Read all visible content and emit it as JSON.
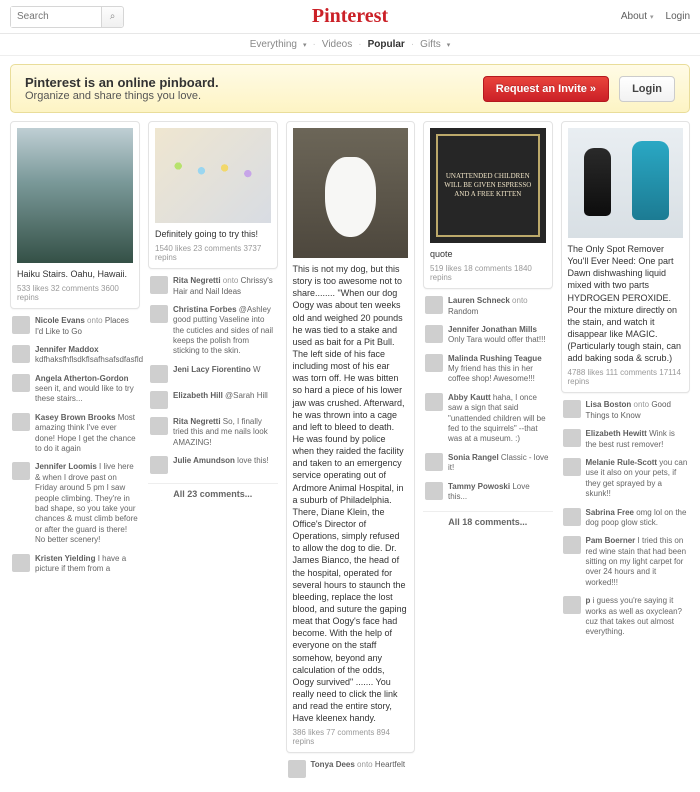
{
  "header": {
    "search_placeholder": "Search",
    "logo": "Pinterest",
    "about": "About",
    "login": "Login"
  },
  "categories": {
    "everything": "Everything",
    "videos": "Videos",
    "popular": "Popular",
    "gifts": "Gifts"
  },
  "banner": {
    "title": "Pinterest is an online pinboard.",
    "subtitle": "Organize and share things you love.",
    "request": "Request an Invite »",
    "login": "Login"
  },
  "pins": {
    "p1": {
      "desc": "Haiku Stairs. Oahu, Hawaii.",
      "stats": "533 likes  32 comments  3600 repins",
      "comments": [
        {
          "name": "Nicole Evans",
          "onto": "onto",
          "board": "Places I'd Like to Go",
          "text": ""
        },
        {
          "name": "Jennifer Maddox",
          "text": "kdfhaksfhflsdkflsafhsafsdfasfld"
        },
        {
          "name": "Angela Atherton-Gordon",
          "text": "seen it, and would like to try these stairs..."
        },
        {
          "name": "Kasey Brown Brooks",
          "text": "Most amazing think I've ever done! Hope I get the chance to do it again"
        },
        {
          "name": "Jennifer Loomis",
          "text": "I live here & when I drove past on Friday around 5 pm I saw people climbing. They're in bad shape, so you take your chances & must climb before or after the guard is there! No better scenery!"
        },
        {
          "name": "Kristen Yielding",
          "text": "I have a picture if them from a"
        }
      ]
    },
    "p2": {
      "desc": "Definitely going to try this!",
      "stats": "1540 likes  23 comments  3737 repins",
      "comments": [
        {
          "name": "Rita Negretti",
          "onto": "onto",
          "board": "Chrissy's Hair and Nail Ideas",
          "text": ""
        },
        {
          "name": "Christina Forbes",
          "text": "@Ashley good putting Vaseline into the cuticles and sides of nail keeps the polish from sticking to the skin."
        },
        {
          "name": "Jeni Lacy Fiorentino",
          "text": "W"
        },
        {
          "name": "Elizabeth Hill",
          "text": "@Sarah Hill"
        },
        {
          "name": "Rita Negretti",
          "text": "So, I finally tried this and me nails look AMAZING!"
        },
        {
          "name": "Julie Amundson",
          "text": "love this!"
        }
      ],
      "all": "All 23 comments..."
    },
    "p3": {
      "desc": "This is not my dog, but this story is too awesome not to share........ \"When our dog Oogy was about ten weeks old and weighed 20 pounds he was tied to a stake and used as bait for a Pit Bull. The left side of his face including most of his ear was torn off. He was bitten so hard a piece of his lower jaw was crushed. Afterward, he was thrown into a cage and left to bleed to death. He was found by police when they raided the facility and taken to an emergency service operating out of Ardmore Animal Hospital, in a suburb of Philadelphia. There, Diane Klein, the Office's Director of Operations, simply refused to allow the dog to die. Dr. James Bianco, the head of the hospital, operated for several hours to staunch the bleeding, replace the lost blood, and suture the gaping meat that Oogy's face had become. With the help of everyone on the staff somehow, beyond any calculation of the odds, Oogy survived\" ....... You really need to click the link and read the entire story, Have kleenex handy.",
      "stats": "386 likes  77 comments  894 repins",
      "comments": [
        {
          "name": "Tonya Dees",
          "onto": "onto",
          "board": "Heartfelt",
          "text": ""
        }
      ]
    },
    "p4": {
      "chalk_text": "UNATTENDED CHILDREN WILL BE GIVEN ESPRESSO AND A FREE KITTEN",
      "desc": "quote",
      "stats": "519 likes  18 comments  1840 repins",
      "comments": [
        {
          "name": "Lauren Schneck",
          "onto": "onto",
          "board": "Random",
          "text": ""
        },
        {
          "name": "Jennifer Jonathan Mills",
          "text": "Only Tara would offer that!!!"
        },
        {
          "name": "Malinda Rushing Teague",
          "text": "My friend has this in her coffee shop! Awesome!!!"
        },
        {
          "name": "Abby Kautt",
          "text": "haha, I once saw a sign that said \"unattended children will be fed to the squirrels\" --that was at a museum. :)"
        },
        {
          "name": "Sonia Rangel",
          "text": "Classic - love it!"
        },
        {
          "name": "Tammy Powoski",
          "text": "Love this..."
        }
      ],
      "all": "All 18 comments..."
    },
    "p5": {
      "desc": "The Only Spot Remover You'll Ever Need: One part Dawn dishwashing liquid mixed with two parts HYDROGEN PEROXIDE. Pour the mixture directly on the stain, and watch it disappear like MAGIC. (Particularly tough stain, can add baking soda & scrub.)",
      "stats": "4788 likes  111 comments  17114 repins",
      "comments": [
        {
          "name": "Lisa Boston",
          "onto": "onto",
          "board": "Good Things to Know",
          "text": ""
        },
        {
          "name": "Elizabeth Hewitt",
          "text": "Wink is the best rust remover!"
        },
        {
          "name": "Melanie Rule-Scott",
          "text": "you can use it also on your pets, if they get sprayed by a skunk!!"
        },
        {
          "name": "Sabrina Free",
          "text": "omg lol on the dog poop glow stick."
        },
        {
          "name": "Pam Boerner",
          "text": "I tried this on red wine stain that had been sitting on my light carpet for over 24 hours and it worked!!!"
        },
        {
          "name": "p",
          "text": "i guess you're saying it works as well as oxyclean? cuz that takes out almost everything."
        }
      ]
    }
  }
}
